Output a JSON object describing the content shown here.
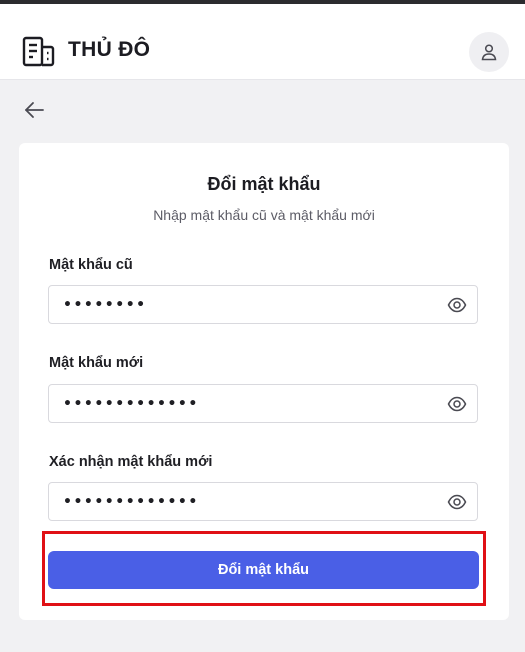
{
  "header": {
    "app_title": "THỦ ĐÔ"
  },
  "card": {
    "title": "Đổi mật khẩu",
    "subtitle": "Nhập mật khẩu cũ và mật khẩu mới"
  },
  "fields": {
    "old_password": {
      "label": "Mật khẩu cũ",
      "value": "••••••••"
    },
    "new_password": {
      "label": "Mật khẩu mới",
      "value": "•••••••••••••"
    },
    "confirm_password": {
      "label": "Xác nhận mật khẩu mới",
      "value": "•••••••••••••"
    }
  },
  "submit": {
    "label": "Đổi mật khẩu"
  },
  "colors": {
    "primary": "#4a5fe6",
    "highlight": "#e01015"
  }
}
